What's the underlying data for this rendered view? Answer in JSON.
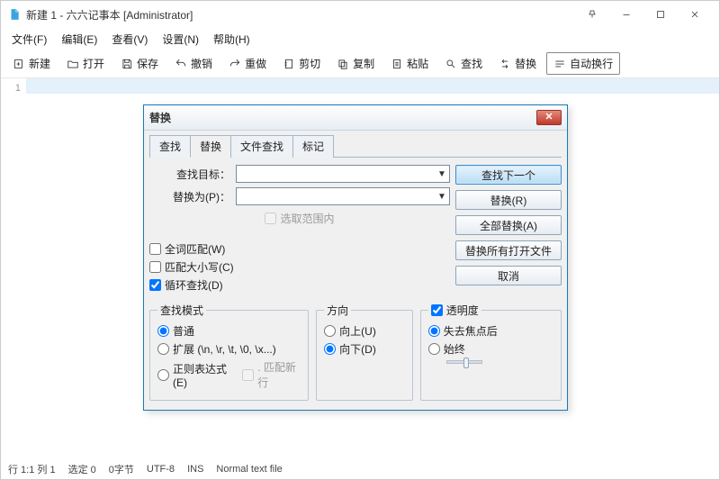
{
  "title": "新建 1 - 六六记事本 [Administrator]",
  "menu": {
    "file": "文件(F)",
    "edit": "编辑(E)",
    "view": "查看(V)",
    "settings": "设置(N)",
    "help": "帮助(H)"
  },
  "toolbar": {
    "new_": "新建",
    "open": "打开",
    "save": "保存",
    "undo": "撤销",
    "redo": "重做",
    "cut": "剪切",
    "copy": "复制",
    "paste": "粘贴",
    "find": "查找",
    "replace": "替换",
    "wrap": "自动换行"
  },
  "gutter": {
    "line1": "1"
  },
  "dialog": {
    "title": "替换",
    "tabs": {
      "find": "查找",
      "replace": "替换",
      "file_find": "文件查找",
      "mark": "标记"
    },
    "find_label": "查找目标：",
    "replace_label": "替换为(P)：",
    "find_value": "",
    "replace_value": "",
    "in_selection": "选取范围内",
    "whole_word": "全词匹配(W)",
    "match_case": "匹配大小写(C)",
    "wrap_around": "循环查找(D)",
    "mode_legend": "查找模式",
    "mode_normal": "普通",
    "mode_extended": "扩展 (\\n, \\r, \\t, \\0, \\x...)",
    "mode_regex": "正则表达式(E)",
    "mode_newline": ". 匹配新行",
    "dir_legend": "方向",
    "dir_up": "向上(U)",
    "dir_down": "向下(D)",
    "trans_legend": "透明度",
    "trans_onlose": "失去焦点后",
    "trans_always": "始终",
    "btn_find_next": "查找下一个",
    "btn_replace": "替换(R)",
    "btn_replace_all": "全部替换(A)",
    "btn_replace_all_open": "替换所有打开文件",
    "btn_cancel": "取消"
  },
  "status": {
    "pos": "行 1:1  列 1",
    "sel": "选定 0",
    "bytes": "0字节",
    "enc": "UTF-8",
    "mode": "INS",
    "filetype": "Normal text file"
  }
}
